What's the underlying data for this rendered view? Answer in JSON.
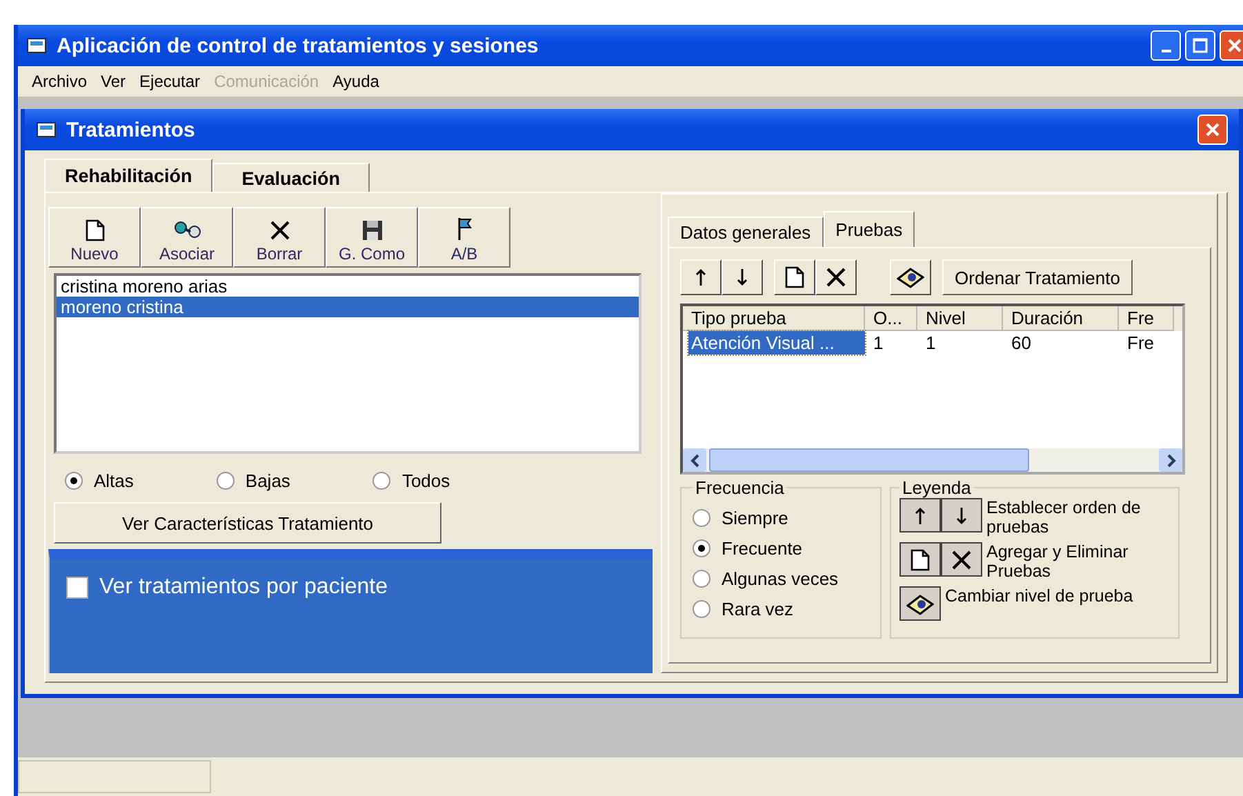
{
  "window": {
    "title": "Aplicación de control de tratamientos y sesiones"
  },
  "menu": [
    {
      "label": "Archivo",
      "disabled": false
    },
    {
      "label": "Ver",
      "disabled": false
    },
    {
      "label": "Ejecutar",
      "disabled": false
    },
    {
      "label": "Comunicación",
      "disabled": true
    },
    {
      "label": "Ayuda",
      "disabled": false
    }
  ],
  "child_window": {
    "title": "Tratamientos"
  },
  "tabs": [
    {
      "label": "Rehabilitación",
      "selected": true
    },
    {
      "label": "Evaluación",
      "selected": false
    }
  ],
  "toolbar": [
    {
      "label": "Nuevo",
      "kind": "page"
    },
    {
      "label": "Asociar",
      "kind": "link"
    },
    {
      "label": "Borrar",
      "kind": "cross"
    },
    {
      "label": "G. Como",
      "kind": "disk"
    },
    {
      "label": "A/B",
      "kind": "flag"
    }
  ],
  "patients": [
    {
      "name": "cristina moreno arias",
      "selected": false
    },
    {
      "name": "moreno cristina",
      "selected": true
    }
  ],
  "filter": [
    {
      "label": "Altas",
      "selected": true
    },
    {
      "label": "Bajas",
      "selected": false
    },
    {
      "label": "Todos",
      "selected": false
    }
  ],
  "details_button": "Ver Características Tratamiento",
  "patient_view": {
    "label": "Ver tratamientos por paciente",
    "checked": false
  },
  "sub_tabs": [
    {
      "label": "Datos generales",
      "selected": false
    },
    {
      "label": "Pruebas",
      "selected": true
    }
  ],
  "order_button": "Ordenar Tratamiento",
  "tests_table": {
    "columns": [
      "Tipo prueba",
      "O...",
      "Nivel",
      "Duración",
      "Fre"
    ],
    "rows": [
      {
        "cells": [
          "Atención Visual ...",
          "1",
          "1",
          "60",
          "Fre"
        ],
        "selected": true
      }
    ]
  },
  "frequency": {
    "title": "Frecuencia",
    "options": [
      {
        "label": "Siempre",
        "selected": false
      },
      {
        "label": "Frecuente",
        "selected": true
      },
      {
        "label": "Algunas veces",
        "selected": false
      },
      {
        "label": "Rara vez",
        "selected": false
      }
    ]
  },
  "legend": {
    "title": "Leyenda",
    "items": [
      {
        "kind": "order",
        "text": "Establecer orden de pruebas"
      },
      {
        "kind": "add_remove",
        "text": "Agregar y Eliminar Pruebas"
      },
      {
        "kind": "level",
        "text": "Cambiar nivel de prueba"
      }
    ]
  }
}
